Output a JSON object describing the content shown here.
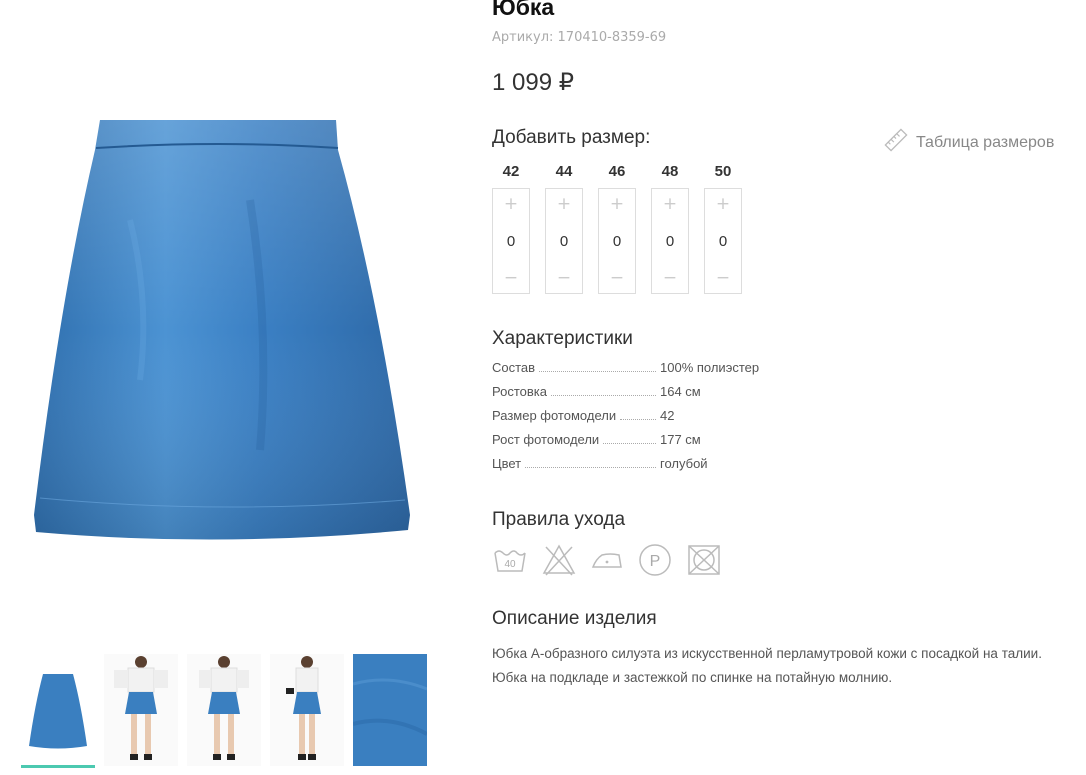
{
  "product": {
    "title": "Юбка",
    "sku": "Артикул: 170410-8359-69",
    "price": "1 099 ₽"
  },
  "sizes": {
    "label": "Добавить размер:",
    "table_link": "Таблица размеров",
    "items": [
      {
        "size": "42",
        "qty": "0",
        "plus": "+",
        "minus": "−"
      },
      {
        "size": "44",
        "qty": "0",
        "plus": "+",
        "minus": "−"
      },
      {
        "size": "46",
        "qty": "0",
        "plus": "+",
        "minus": "−"
      },
      {
        "size": "48",
        "qty": "0",
        "plus": "+",
        "minus": "−"
      },
      {
        "size": "50",
        "qty": "0",
        "plus": "+",
        "minus": "−"
      }
    ]
  },
  "characteristics": {
    "title": "Характеристики",
    "rows": [
      {
        "key": "Состав",
        "value": "100% полиэстер"
      },
      {
        "key": "Ростовка",
        "value": "164 см"
      },
      {
        "key": "Размер фотомодели",
        "value": "42"
      },
      {
        "key": "Рост фотомодели",
        "value": "177 см"
      },
      {
        "key": "Цвет",
        "value": "голубой"
      }
    ]
  },
  "care": {
    "title": "Правила ухода",
    "wash_temp": "40",
    "dry_clean_letter": "P",
    "icons": [
      "wash-40-icon",
      "no-bleach-icon",
      "iron-low-icon",
      "dry-clean-p-icon",
      "no-tumble-dry-icon"
    ]
  },
  "description": {
    "title": "Описание изделия",
    "text": "Юбка А-образного силуэта из искусственной перламутровой кожи с посадкой на талии. Юбка на подкладе и застежкой по спинке на потайную молнию."
  },
  "gallery": {
    "thumbnails": [
      "skirt-front",
      "model-front",
      "model-back",
      "model-side",
      "fabric-closeup"
    ],
    "active_index": 0
  },
  "colors": {
    "skirt": "#3a7fc0",
    "accent": "#4cc9b0",
    "muted": "#aaaaaa"
  }
}
